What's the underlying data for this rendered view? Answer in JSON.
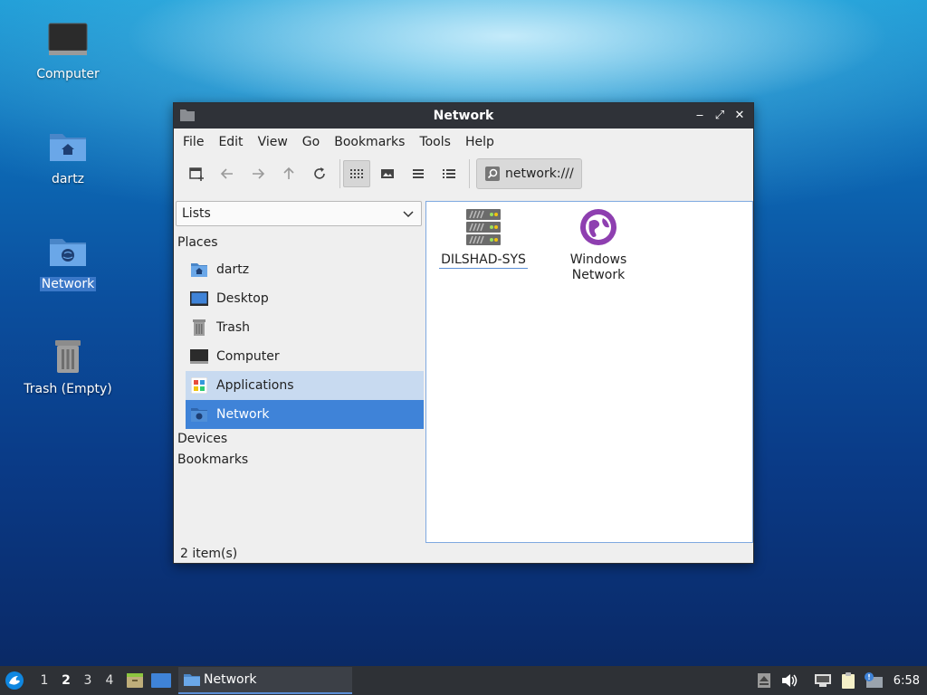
{
  "desktop": {
    "icons": [
      {
        "label": "Computer"
      },
      {
        "label": "dartz"
      },
      {
        "label": "Network"
      },
      {
        "label": "Trash (Empty)"
      }
    ]
  },
  "window": {
    "title": "Network",
    "controls": {
      "minimize": "‒",
      "maximize": "⤢",
      "close": "✕"
    },
    "menu": [
      "File",
      "Edit",
      "View",
      "Go",
      "Bookmarks",
      "Tools",
      "Help"
    ],
    "path": "network:///",
    "side_combo": {
      "selected": "Lists"
    },
    "sections": {
      "places": "Places",
      "devices": "Devices",
      "bookmarks": "Bookmarks"
    },
    "places": [
      {
        "label": "dartz",
        "icon": "home-folder-icon"
      },
      {
        "label": "Desktop",
        "icon": "desktop-icon"
      },
      {
        "label": "Trash",
        "icon": "trash-icon"
      },
      {
        "label": "Computer",
        "icon": "computer-icon"
      },
      {
        "label": "Applications",
        "icon": "applications-icon"
      },
      {
        "label": "Network",
        "icon": "network-folder-icon"
      }
    ],
    "items": [
      {
        "label": "DILSHAD-SYS",
        "icon": "server-icon"
      },
      {
        "label": "Windows Network",
        "icon": "windows-network-icon"
      }
    ],
    "status": "2 item(s)"
  },
  "taskbar": {
    "workspaces": [
      "1",
      "2",
      "3",
      "4"
    ],
    "current_workspace": "2",
    "task_label": "Network",
    "clock": "6:58"
  },
  "colors": {
    "selection": "#3f83d8",
    "hover": "#c8daf0",
    "titlebar": "#2f3238",
    "taskbar": "#2e3136"
  }
}
